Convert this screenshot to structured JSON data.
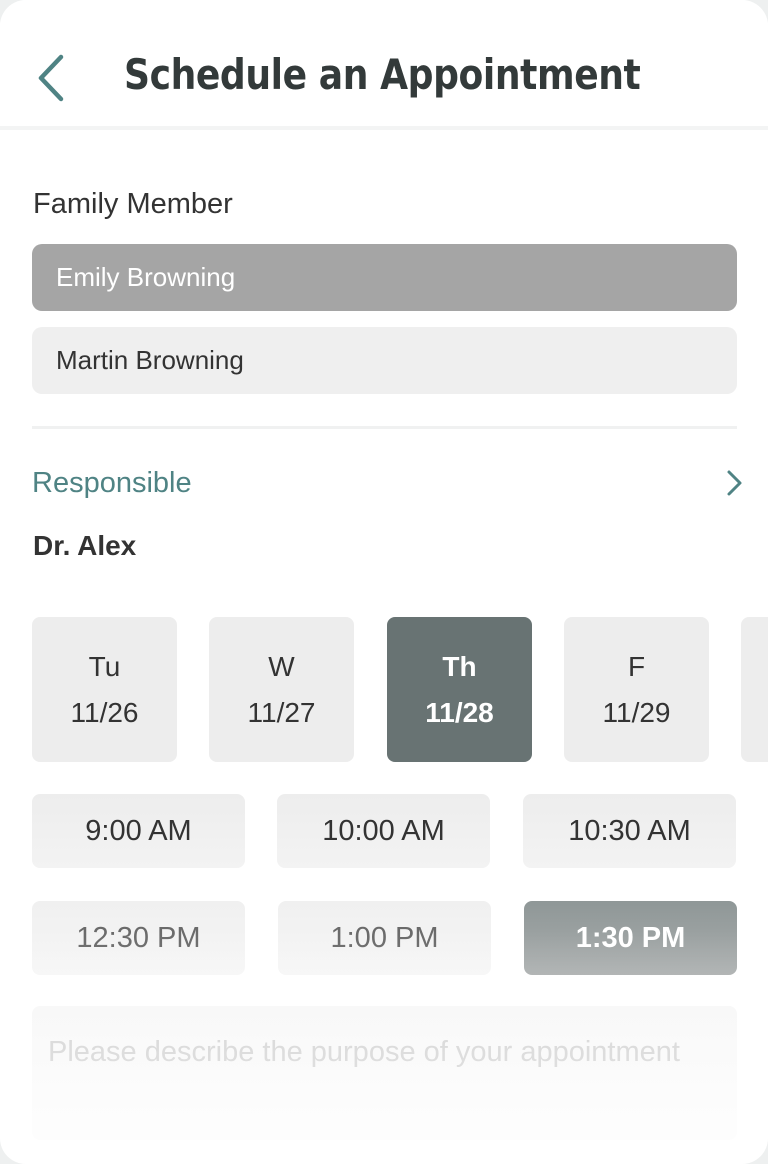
{
  "header": {
    "title": "Schedule an Appointment",
    "back_icon": "chevron-left-icon"
  },
  "family": {
    "label": "Family Member",
    "members": [
      {
        "name": "Emily Browning",
        "selected": true
      },
      {
        "name": "Martin Browning",
        "selected": false
      }
    ]
  },
  "responsible": {
    "label": "Responsible",
    "doctor": "Dr. Alex",
    "chevron_icon": "chevron-right-icon"
  },
  "days": [
    {
      "weekday": "Tu",
      "date": "11/26",
      "selected": false
    },
    {
      "weekday": "W",
      "date": "11/27",
      "selected": false
    },
    {
      "weekday": "Th",
      "date": "11/28",
      "selected": true
    },
    {
      "weekday": "F",
      "date": "11/29",
      "selected": false
    }
  ],
  "slots": [
    {
      "time": "9:00 AM",
      "state": "normal"
    },
    {
      "time": "10:00 AM",
      "state": "normal"
    },
    {
      "time": "10:30 AM",
      "state": "normal"
    },
    {
      "time": "12:30 PM",
      "state": "faded"
    },
    {
      "time": "1:00 PM",
      "state": "faded"
    },
    {
      "time": "1:30 PM",
      "state": "selected"
    }
  ],
  "purpose": {
    "placeholder": "Please describe the purpose of your appointment"
  },
  "colors": {
    "accent": "#4f8384",
    "selected_day": "#687373",
    "selected_member": "#a5a5a5"
  }
}
